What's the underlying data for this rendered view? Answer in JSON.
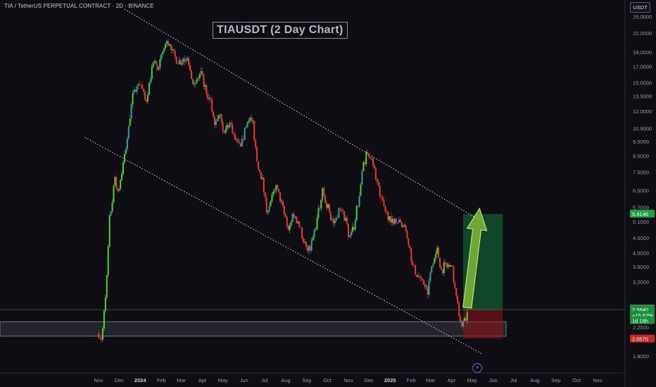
{
  "header": {
    "symbol_line": "TIA / TetherUS PERPETUAL CONTRACT · 2D · BINANCE",
    "currency_button": "USDT"
  },
  "chart_data": {
    "type": "candlestick",
    "title": "TIAUSDT (2 Day Chart)",
    "y_scale": "log",
    "ylim": [
      1.65,
      25.5
    ],
    "y_ticks": [
      "25.0000",
      "22.0000",
      "19.0000",
      "17.0000",
      "15.0000",
      "13.5000",
      "12.0000",
      "10.5000",
      "9.5000",
      "8.5000",
      "7.5000",
      "6.5000",
      "5.7000",
      "5.1000",
      "4.5000",
      "4.0000",
      "3.6000",
      "3.2000",
      "2.5000",
      "2.2500",
      "1.8000"
    ],
    "x_ticks": [
      "Nov",
      "Dec",
      "2024",
      "Feb",
      "Mar",
      "Apr",
      "May",
      "Jun",
      "Jul",
      "Aug",
      "Sep",
      "Oct",
      "Nov",
      "Dec",
      "2025",
      "Feb",
      "Mar",
      "Apr",
      "May",
      "Jun",
      "Jul",
      "Aug",
      "Sep",
      "Oct",
      "Nov"
    ],
    "colors": {
      "up": "#26a69a",
      "up_bright": "#4fd13a",
      "down": "#e53935",
      "background": "#0e0d14"
    },
    "price_path": [
      [
        "2023-11-01",
        2.15
      ],
      [
        "2023-11-06",
        2.05
      ],
      [
        "2023-11-09",
        2.6
      ],
      [
        "2023-11-13",
        3.3
      ],
      [
        "2023-11-17",
        5.2
      ],
      [
        "2023-11-21",
        6.0
      ],
      [
        "2023-11-25",
        7.2
      ],
      [
        "2023-11-29",
        6.4
      ],
      [
        "2023-12-03",
        7.1
      ],
      [
        "2023-12-09",
        8.5
      ],
      [
        "2023-12-15",
        10.5
      ],
      [
        "2023-12-19",
        13.0
      ],
      [
        "2023-12-25",
        14.2
      ],
      [
        "2024-01-01",
        15.0
      ],
      [
        "2024-01-09",
        12.8
      ],
      [
        "2024-01-15",
        15.5
      ],
      [
        "2024-01-21",
        17.5
      ],
      [
        "2024-01-27",
        16.2
      ],
      [
        "2024-02-04",
        19.5
      ],
      [
        "2024-02-10",
        20.5
      ],
      [
        "2024-02-16",
        19.2
      ],
      [
        "2024-02-22",
        18.0
      ],
      [
        "2024-03-02",
        17.5
      ],
      [
        "2024-03-10",
        18.5
      ],
      [
        "2024-03-16",
        15.5
      ],
      [
        "2024-03-22",
        15.0
      ],
      [
        "2024-03-30",
        16.0
      ],
      [
        "2024-04-07",
        14.0
      ],
      [
        "2024-04-13",
        12.8
      ],
      [
        "2024-04-19",
        11.0
      ],
      [
        "2024-04-27",
        12.0
      ],
      [
        "2024-05-03",
        10.0
      ],
      [
        "2024-05-11",
        11.2
      ],
      [
        "2024-05-19",
        9.5
      ],
      [
        "2024-05-27",
        9.0
      ],
      [
        "2024-06-02",
        10.2
      ],
      [
        "2024-06-08",
        11.5
      ],
      [
        "2024-06-14",
        10.8
      ],
      [
        "2024-06-20",
        8.2
      ],
      [
        "2024-06-28",
        7.0
      ],
      [
        "2024-07-04",
        5.6
      ],
      [
        "2024-07-10",
        6.0
      ],
      [
        "2024-07-18",
        6.6
      ],
      [
        "2024-07-24",
        6.1
      ],
      [
        "2024-08-01",
        5.2
      ],
      [
        "2024-08-05",
        4.7
      ],
      [
        "2024-08-11",
        5.4
      ],
      [
        "2024-08-19",
        5.1
      ],
      [
        "2024-08-25",
        4.6
      ],
      [
        "2024-09-02",
        4.0
      ],
      [
        "2024-09-08",
        4.3
      ],
      [
        "2024-09-16",
        5.2
      ],
      [
        "2024-09-24",
        6.4
      ],
      [
        "2024-10-02",
        5.7
      ],
      [
        "2024-10-10",
        5.0
      ],
      [
        "2024-10-18",
        5.6
      ],
      [
        "2024-10-26",
        5.3
      ],
      [
        "2024-11-03",
        4.5
      ],
      [
        "2024-11-09",
        4.9
      ],
      [
        "2024-11-17",
        6.3
      ],
      [
        "2024-11-23",
        8.0
      ],
      [
        "2024-11-29",
        8.8
      ],
      [
        "2024-12-05",
        8.5
      ],
      [
        "2024-12-11",
        7.2
      ],
      [
        "2024-12-19",
        6.0
      ],
      [
        "2024-12-27",
        5.4
      ],
      [
        "2025-01-04",
        5.2
      ],
      [
        "2025-01-12",
        5.1
      ],
      [
        "2025-01-20",
        5.0
      ],
      [
        "2025-01-28",
        4.4
      ],
      [
        "2025-02-03",
        3.6
      ],
      [
        "2025-02-09",
        3.4
      ],
      [
        "2025-02-17",
        3.2
      ],
      [
        "2025-02-25",
        3.0
      ],
      [
        "2025-03-03",
        3.6
      ],
      [
        "2025-03-11",
        4.1
      ],
      [
        "2025-03-17",
        3.5
      ],
      [
        "2025-03-25",
        3.7
      ],
      [
        "2025-04-02",
        3.5
      ],
      [
        "2025-04-08",
        2.8
      ],
      [
        "2025-04-12",
        2.5
      ],
      [
        "2025-04-16",
        2.25
      ],
      [
        "2025-04-20",
        2.35
      ],
      [
        "2025-04-24",
        2.45
      ]
    ],
    "upper_trendline": [
      [
        "2023-12-09",
        26.5
      ],
      [
        "2025-05-16",
        5.1
      ]
    ],
    "lower_trendline": [
      [
        "2023-10-12",
        9.8
      ],
      [
        "2025-05-16",
        1.83
      ]
    ],
    "support_zone": [
      2.1,
      2.35
    ],
    "target_zone": [
      2.58,
      5.41
    ],
    "stop_zone": [
      2.06,
      2.58
    ],
    "projection_arrow": [
      [
        "2025-04-24",
        2.62
      ],
      [
        "2025-05-12",
        5.65
      ]
    ],
    "price_labels": [
      {
        "text": "5.4146",
        "value": 5.4146,
        "color": "#22a34a"
      },
      {
        "text": "2.5962",
        "value": 2.5962,
        "color": "#7d7d88"
      },
      {
        "text": "2.5840",
        "value": 2.584,
        "color": "#1a8f3c"
      },
      {
        "text": "+15.67%",
        "value": 2.47,
        "color": "#1a8f3c"
      },
      {
        "text": "1d 18h",
        "value": 2.37,
        "color": "#1a8f3c"
      },
      {
        "text": "2.0570",
        "value": 2.057,
        "color": "#c62828"
      }
    ]
  },
  "footer": {
    "icon": "lightning-icon"
  }
}
